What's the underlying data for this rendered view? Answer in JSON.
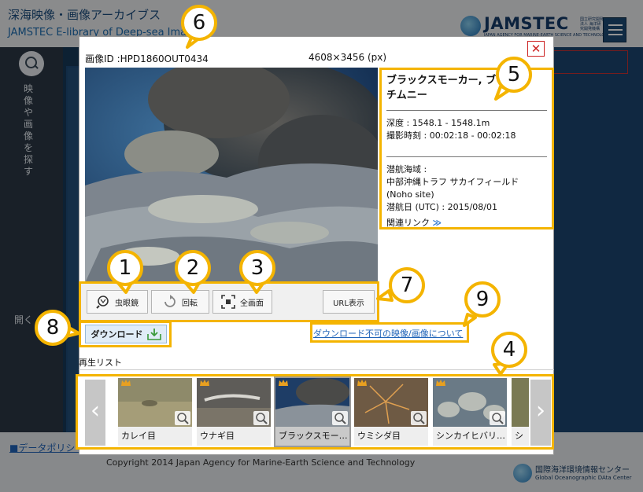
{
  "site": {
    "title": "深海映像・画像アーカイブス",
    "subtitle": "JAMSTEC E-library of Deep-sea Images",
    "logo_text": "JAMSTEC",
    "logo_sub_jp": "国立研究開発法人 海洋研究開発機構",
    "logo_caption": "JAPAN AGENCY FOR MARINE-EARTH SCIENCE AND TECHNOLOGY",
    "sidebar_search_label": "映像や画像を探す",
    "sidebar_open_label": "開く",
    "data_policy": "■データポリシー",
    "copyright": "Copyright 2014 Japan Agency for Marine-Earth Science and Technology",
    "footer_org": "国際海洋環境情報センター",
    "footer_org_en": "Global Oceanographic DAta Center"
  },
  "viewer": {
    "image_id": "画像ID :HPD1860OUT0434",
    "image_size": "4608×3456 (px)",
    "close_label": "✕",
    "info": {
      "title": "ブラックスモーカー, ブラックスモーカー, チムニー",
      "title_visible": "ブラックスモーカー, ブ  ブ チムニー",
      "depth": "深度 : 1548.1 - 1548.1m",
      "shoot_time": "撮影時刻 : 00:02:18 - 00:02:18",
      "area_label": "潜航海域 :",
      "area_value": "中部沖縄トラフ サカイフィールド",
      "area_site": "(Noho site)",
      "dive_date": "潜航日 (UTC) : 2015/08/01",
      "related_links": "関連リンク"
    },
    "toolbar": {
      "magnifier": "虫眼鏡",
      "rotate": "回転",
      "fullscreen": "全画面",
      "show_url": "URL表示"
    },
    "download_label": "ダウンロード",
    "undownloadable_link": "ダウンロード不可の映像/画像について",
    "playlist_label": "再生リスト",
    "playlist": [
      {
        "label": "カレイ目"
      },
      {
        "label": "ウナギ目"
      },
      {
        "label": "ブラックスモー…"
      },
      {
        "label": "ウミシダ目"
      },
      {
        "label": "シンカイヒバリ…"
      },
      {
        "label": "シ"
      }
    ]
  },
  "callouts": [
    "1",
    "2",
    "3",
    "4",
    "5",
    "6",
    "7",
    "8",
    "9"
  ],
  "colors": {
    "callout_border": "#f4b400",
    "link": "#1f63b8",
    "close": "#cc2222"
  }
}
